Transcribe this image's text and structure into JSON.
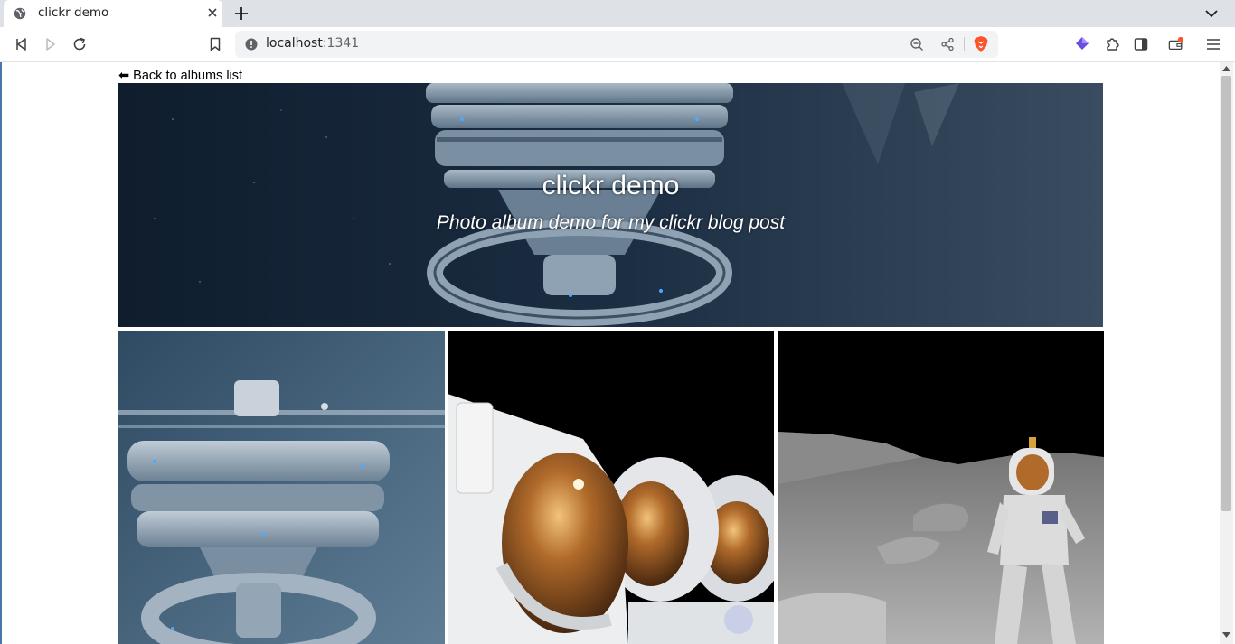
{
  "browser": {
    "tab_title": "clickr demo",
    "url_host": "localhost",
    "url_port": ":1341",
    "extension_badge": "1",
    "icons": [
      "globe-icon",
      "close-icon",
      "plus-icon",
      "chevron-down-icon",
      "back-icon",
      "forward-icon",
      "reload-icon",
      "bookmark-icon",
      "info-icon",
      "zoom-out-icon",
      "share-icon",
      "brave-shields-icon",
      "rewards-icon",
      "extensions-icon",
      "sidebar-icon",
      "wallet-icon",
      "menu-icon"
    ],
    "colors": {
      "tabbar": "#dee1e6",
      "omnibox": "#f1f3f4",
      "brave_orange": "#fb542b"
    }
  },
  "page": {
    "back_link": "⬅ Back to albums list",
    "hero": {
      "title": "clickr demo",
      "subtitle": "Photo album demo for my clickr blog post"
    },
    "photos": [
      {
        "subject": "space station"
      },
      {
        "subject": "astronauts in helmets"
      },
      {
        "subject": "astronaut on the moon"
      }
    ]
  }
}
